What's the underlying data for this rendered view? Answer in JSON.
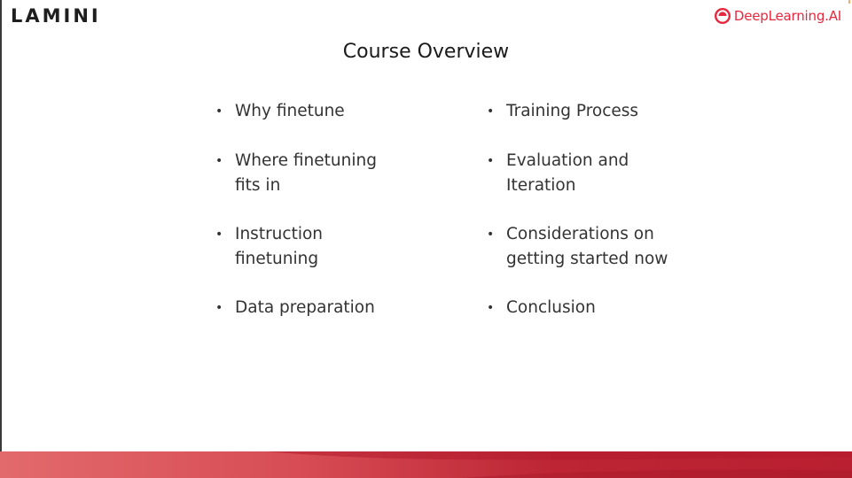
{
  "header": {
    "brand_left": "LAMINI",
    "brand_right": "DeepLearning.AI",
    "brand_right_icon": "deeplearning-logo-icon",
    "accent_color": "#e8283f"
  },
  "title": "Course Overview",
  "bullet_char": "•",
  "columns": [
    {
      "items": [
        {
          "text": "Why finetune"
        },
        {
          "text": "Where finetuning\nfits in"
        },
        {
          "text": "Instruction\nfinetuning"
        },
        {
          "text": "Data preparation"
        }
      ]
    },
    {
      "items": [
        {
          "text": "Training Process"
        },
        {
          "text": "Evaluation and\nIteration"
        },
        {
          "text": "Considerations on\ngetting started now"
        },
        {
          "text": "Conclusion"
        }
      ]
    }
  ],
  "footer": {
    "colors": [
      "#e26a6c",
      "#d74c55",
      "#bd2534",
      "#b91f30"
    ]
  }
}
